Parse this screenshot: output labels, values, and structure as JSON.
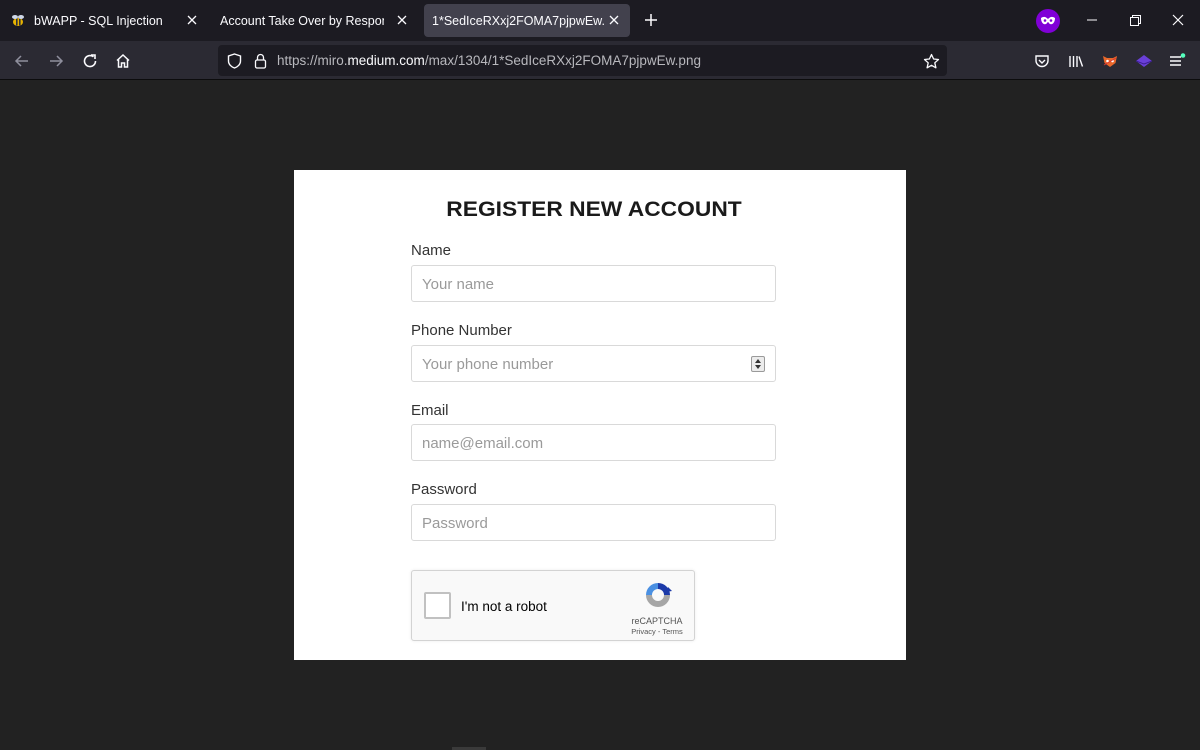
{
  "browser": {
    "tabs": [
      {
        "title": "bWAPP - SQL Injection",
        "active": false
      },
      {
        "title": "Account Take Over by Response Ma",
        "active": false
      },
      {
        "title": "1*SedIceRXxj2FOMA7pjpwEw.png",
        "active": true
      }
    ],
    "url_prefix": "https://miro.",
    "url_domain": "medium.com",
    "url_suffix": "/max/1304/1*SedIceRXxj2FOMA7pjpwEw.png",
    "private_color": "#8000d7"
  },
  "form": {
    "title": "REGISTER NEW ACCOUNT",
    "name_label": "Name",
    "name_placeholder": "Your name",
    "phone_label": "Phone Number",
    "phone_placeholder": "Your phone number",
    "email_label": "Email",
    "email_placeholder": "name@email.com",
    "password_label": "Password",
    "password_placeholder": "Password"
  },
  "captcha": {
    "label": "I'm not a robot",
    "brand": "reCAPTCHA",
    "links": "Privacy - Terms",
    "checked": false
  }
}
